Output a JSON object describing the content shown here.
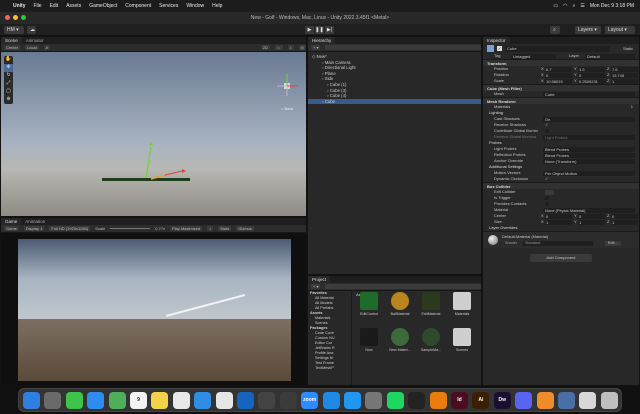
{
  "menubar": {
    "app": "Unity",
    "items": [
      "File",
      "Edit",
      "Assets",
      "GameObject",
      "Component",
      "Services",
      "Window",
      "Help"
    ],
    "datetime": "Mon Dec 9  3:18 PM"
  },
  "window": {
    "title": "New - Golf - Windows, Mac, Linux - Unity 2022.3.45f1 <Metal>"
  },
  "toolbar": {
    "account": "HM",
    "layers": "Layers",
    "layout": "Layout"
  },
  "scene": {
    "tabs": [
      "Scene",
      "Animator"
    ],
    "pivot": "Center",
    "space": "Local",
    "mode": "2D",
    "gizmo_label": "< Back"
  },
  "game": {
    "tabs": [
      "Game",
      "Animation"
    ],
    "view": "Game",
    "display": "Display 1",
    "resolution": "Full HD (1920x1080)",
    "scale_label": "Scale",
    "scale_value": "0.77x",
    "play_mode": "Play Maximized",
    "stats": "Stats",
    "gizmos": "Gizmos"
  },
  "hierarchy": {
    "tab": "Hierarchy",
    "items": [
      {
        "label": "New*",
        "indent": 0
      },
      {
        "label": "Main Camera",
        "indent": 2
      },
      {
        "label": "Directional Light",
        "indent": 2
      },
      {
        "label": "Plane",
        "indent": 2
      },
      {
        "label": "Side",
        "indent": 2
      },
      {
        "label": "Cube (1)",
        "indent": 3
      },
      {
        "label": "Cube (3)",
        "indent": 3
      },
      {
        "label": "Cube (4)",
        "indent": 3
      },
      {
        "label": "Cube",
        "indent": 2
      }
    ]
  },
  "project": {
    "tab": "Project",
    "tree": [
      "Favorites",
      "All Material",
      "All Models",
      "All Prefabs",
      "Assets",
      "Materials",
      "Scenes",
      "Packages",
      "Code Cove",
      "Custom NU",
      "Editor Cor",
      "JetBrains R",
      "Profile Ana",
      "Settings M",
      "Test Frame",
      "TextMeshP"
    ],
    "breadcrumb": "Assets",
    "assets": [
      "EditControl",
      "BallMaterial",
      "EditMaterial",
      "Materials",
      "Now",
      "New Materi...",
      "SampleMa...",
      "Scenes"
    ]
  },
  "inspector": {
    "tab": "Inspector",
    "object_name": "Cube",
    "static_label": "Static",
    "tag_label": "Tag",
    "tag": "Untagged",
    "layer_label": "Layer",
    "layer": "Default",
    "transform": {
      "title": "Transform",
      "position_label": "Position",
      "rotation_label": "Rotation",
      "scale_label": "Scale",
      "position": [
        "6.7",
        "1.5",
        "7.6"
      ],
      "rotation": [
        "0",
        "0",
        "15.745"
      ],
      "scale": [
        "10.58015",
        "0.2509231",
        "1"
      ]
    },
    "mesh_filter": {
      "title": "Cube (Mesh Filter)",
      "mesh_label": "Mesh",
      "mesh": "Cube"
    },
    "mesh_renderer": {
      "title": "Mesh Renderer",
      "materials_label": "Materials",
      "materials_count": "1",
      "lighting": "Lighting",
      "cast_shadows_label": "Cast Shadows",
      "cast_shadows": "On",
      "receive_shadows_label": "Receive Shadows",
      "contribute_gi_label": "Contribute Global Illumin",
      "receive_gi_label": "Receive Global Illumina",
      "receive_gi": "Light Probes",
      "probes": "Probes",
      "light_probes_label": "Light Probes",
      "light_probes": "Blend Probes",
      "reflection_probes_label": "Reflection Probes",
      "reflection_probes": "Blend Probes",
      "anchor_label": "Anchor Override",
      "anchor": "None (Transform)",
      "additional": "Additional Settings",
      "motion_label": "Motion Vectors",
      "motion": "Per Object Motion",
      "occlusion_label": "Dynamic Occlusion"
    },
    "box_collider": {
      "title": "Box Collider",
      "edit_label": "Edit Collider",
      "trigger_label": "Is Trigger",
      "contacts_label": "Provides Contacts",
      "material_label": "Material",
      "material": "None (Physic Material)",
      "center_label": "Center",
      "center": [
        "0",
        "0",
        "0"
      ],
      "size_label": "Size",
      "size": [
        "1",
        "1",
        "1"
      ],
      "overrides": "Layer Overrides"
    },
    "material_name": "Default-Material (Material)",
    "shader_label": "Shader",
    "shader": "Standard",
    "edit_button": "Edit...",
    "add_component": "Add Component"
  },
  "dock": {
    "items": [
      {
        "name": "finder-icon",
        "label": "",
        "color": "#2f7fe0"
      },
      {
        "name": "launchpad-icon",
        "label": "",
        "color": "#6a6a6a"
      },
      {
        "name": "messages-icon",
        "label": "",
        "color": "#3ec34b"
      },
      {
        "name": "mail-icon",
        "label": "",
        "color": "#2d8cf0"
      },
      {
        "name": "maps-icon",
        "label": "",
        "color": "#4fae5a"
      },
      {
        "name": "calendar-icon",
        "label": "9",
        "color": "#f2f2f2"
      },
      {
        "name": "notes-icon",
        "label": "",
        "color": "#f3d34a"
      },
      {
        "name": "photos-icon",
        "label": "",
        "color": "#e8e8e8"
      },
      {
        "name": "safari-icon",
        "label": "",
        "color": "#2f8de4"
      },
      {
        "name": "chrome-icon",
        "label": "",
        "color": "#e6e6e6"
      },
      {
        "name": "outlook-icon",
        "label": "",
        "color": "#1565c0"
      },
      {
        "name": "unity-icon",
        "label": "",
        "color": "#444444"
      },
      {
        "name": "unity-hub-icon",
        "label": "",
        "color": "#3b3b3b"
      },
      {
        "name": "zoom-icon",
        "label": "zoom",
        "color": "#2d8cff"
      },
      {
        "name": "vscode-icon",
        "label": "",
        "color": "#1e88e5"
      },
      {
        "name": "app-store-icon",
        "label": "",
        "color": "#2196f3"
      },
      {
        "name": "system-settings-icon",
        "label": "",
        "color": "#777777"
      },
      {
        "name": "spotify-icon",
        "label": "",
        "color": "#1ed760"
      },
      {
        "name": "github-icon",
        "label": "",
        "color": "#222222"
      },
      {
        "name": "blender-icon",
        "label": "",
        "color": "#e87d0d"
      },
      {
        "name": "indesign-icon",
        "label": "Id",
        "color": "#4b0d1f"
      },
      {
        "name": "illustrator-icon",
        "label": "Ai",
        "color": "#3a1f00"
      },
      {
        "name": "dreamweaver-icon",
        "label": "Dw",
        "color": "#1a0f2e"
      },
      {
        "name": "discord-icon",
        "label": "",
        "color": "#5865f2"
      },
      {
        "name": "books-icon",
        "label": "",
        "color": "#f08c2c"
      },
      {
        "name": "preview-icon",
        "label": "",
        "color": "#4a6fa5"
      },
      {
        "name": "downloads-icon",
        "label": "",
        "color": "#d8d8d8"
      },
      {
        "name": "trash-icon",
        "label": "",
        "color": "#bfbfbf"
      }
    ]
  }
}
